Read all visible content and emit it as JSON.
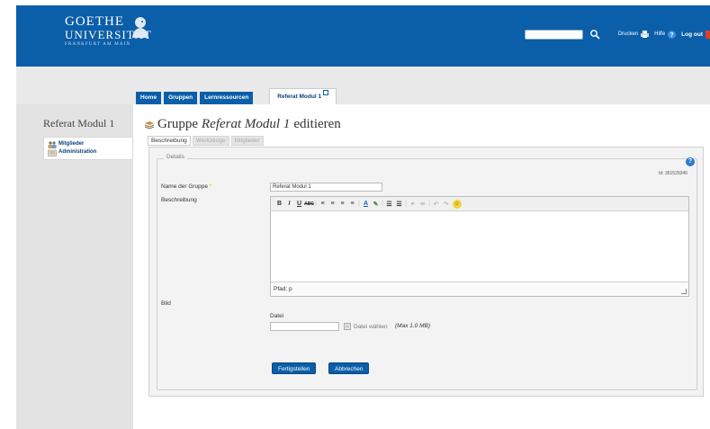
{
  "header": {
    "logo_line1": "GOETHE",
    "logo_line2": "UNIVERSITÄT",
    "logo_line3": "FRANKFURT AM MAIN",
    "print_label": "Drucken",
    "help_label": "Hilfe",
    "logout_label": "Log out",
    "search_placeholder": ""
  },
  "nav_tabs": [
    {
      "label": "Home"
    },
    {
      "label": "Gruppen"
    },
    {
      "label": "Lernressourcen"
    }
  ],
  "active_tab": {
    "label": "Referat Modul 1"
  },
  "sidebar": {
    "title": "Referat Modul 1",
    "items": [
      {
        "label": "Mitglieder",
        "icon": "members-icon"
      },
      {
        "label": "Administration",
        "icon": "administration-icon"
      }
    ]
  },
  "main": {
    "title_prefix": "Gruppe",
    "title_group": "Referat Modul 1",
    "title_suffix": "editieren",
    "subtabs": [
      {
        "label": "Beschreibung",
        "active": true
      },
      {
        "label": "Werkzeuge",
        "active": false
      },
      {
        "label": "Mitglieder",
        "active": false
      }
    ],
    "legend": "Details",
    "id_text": "Id: 361529346",
    "help_icon_text": "?",
    "name_label": "Name der Gruppe",
    "required_marker": "*",
    "name_value": "Referat Modul 1",
    "description_label": "Beschreibung",
    "editor_path": "Pfad: p",
    "image_label": "Bild",
    "file_label": "Datei",
    "file_button": "Datei wählen",
    "max_size": "(Max 1.0 MB)",
    "save_button": "Fertigstellen",
    "cancel_button": "Abbrechen"
  },
  "toolbar": {
    "bold": "B",
    "italic": "I",
    "underline": "U",
    "strike": "ABC",
    "align_left": "≡",
    "align_center": "≡",
    "align_right": "≡",
    "justify": "≡",
    "text_color": "A",
    "bg_color": "✎",
    "bullets": "☰",
    "numbers": "☰",
    "link": "⚭",
    "unlink": "⚮",
    "undo": "↶",
    "redo": "↷",
    "smiley": "☺"
  },
  "colors": {
    "brand_blue": "#0b5ea8",
    "required": "#f0a800"
  }
}
